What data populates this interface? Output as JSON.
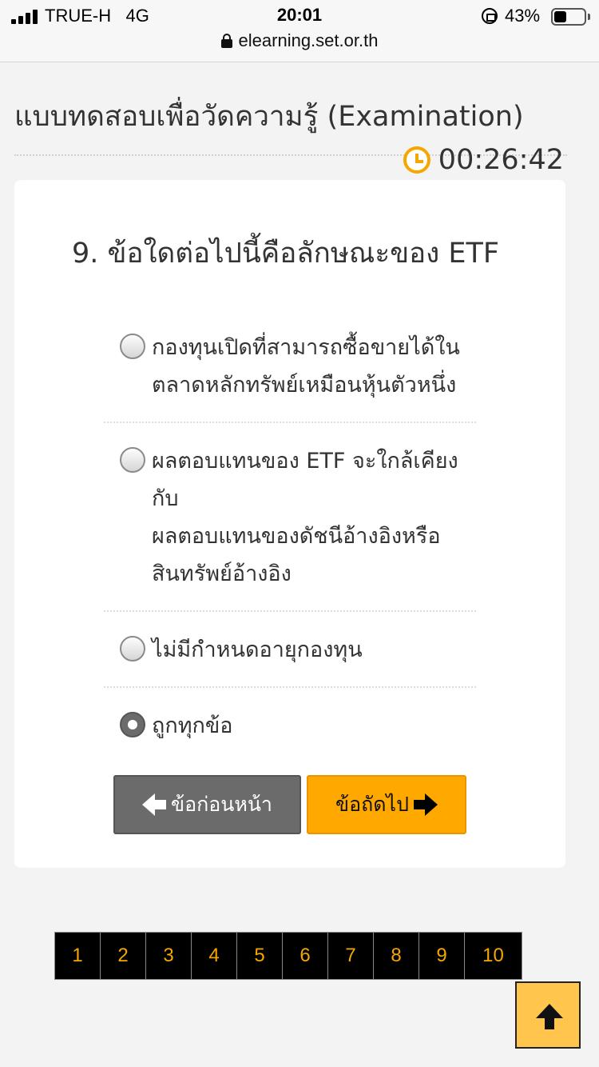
{
  "status_bar": {
    "carrier": "TRUE-H",
    "network": "4G",
    "time": "20:01",
    "battery_percent": "43%",
    "battery_level": 0.43,
    "icons": [
      "signal-icon",
      "rotation-lock-icon",
      "battery-icon"
    ]
  },
  "browser": {
    "url": "elearning.set.or.th",
    "lock_icon": "lock-icon"
  },
  "page": {
    "title": "แบบทดสอบเพื่อวัดความรู้ (Examination)",
    "timer": "00:26:42",
    "timer_icon": "clock-icon",
    "timer_color": "#f5a700"
  },
  "question": {
    "text": "9. ข้อใดต่อไปนี้คือลักษณะของ ETF",
    "options": [
      {
        "lines": [
          "กองทุนเปิดที่สามารถซื้อขายได้ใน",
          "ตลาดหลักทรัพย์เหมือนหุ้นตัวหนึ่ง"
        ],
        "selected": false
      },
      {
        "lines": [
          "ผลตอบแทนของ ETF จะใกล้เคียงกับ",
          "ผลตอบแทนของดัชนีอ้างอิงหรือ",
          "สินทรัพย์อ้างอิง"
        ],
        "selected": false
      },
      {
        "lines": [
          "ไม่มีกำหนดอายุกองทุน"
        ],
        "selected": false
      },
      {
        "lines": [
          "ถูกทุกข้อ"
        ],
        "selected": true
      }
    ]
  },
  "nav": {
    "prev_label": "ข้อก่อนหน้า",
    "next_label": "ข้อถัดไป",
    "prev_color": "#6b6b6b",
    "next_color": "#ffa800"
  },
  "pagination": [
    "1",
    "2",
    "3",
    "4",
    "5",
    "6",
    "7",
    "8",
    "9",
    "10"
  ],
  "back_to_top": {
    "icon": "up-arrow-icon",
    "color": "#ffc54d"
  }
}
